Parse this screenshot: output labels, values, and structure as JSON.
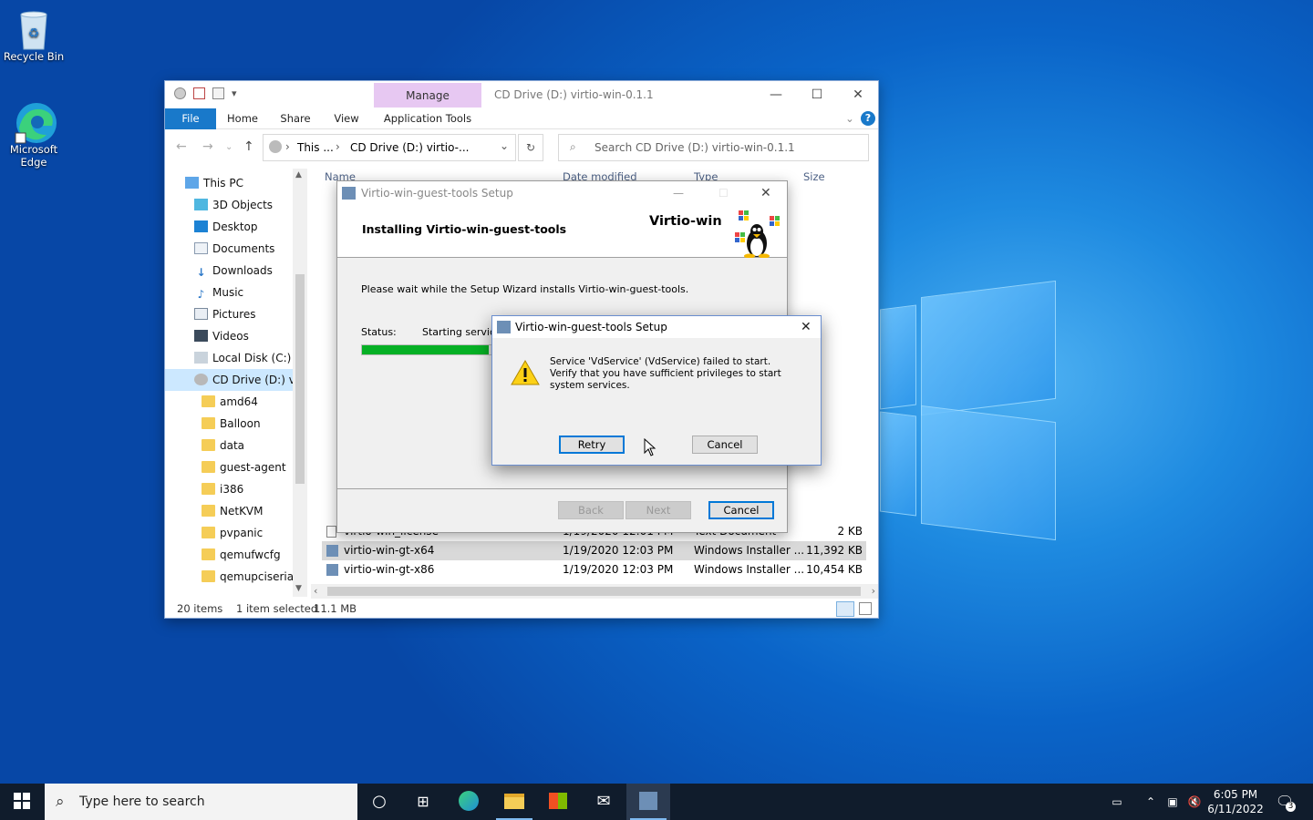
{
  "desktop": {
    "icons": [
      {
        "label": "Recycle Bin",
        "icon": "recycle-bin-icon"
      },
      {
        "label": "Microsoft Edge",
        "icon": "edge-icon"
      }
    ]
  },
  "explorer": {
    "manage_tab": "Manage",
    "title": "CD Drive (D:) virtio-win-0.1.1",
    "ribbon_tabs": [
      "File",
      "Home",
      "Share",
      "View",
      "Application Tools"
    ],
    "breadcrumb": [
      "This ...",
      "CD Drive (D:) virtio-..."
    ],
    "search_placeholder": "Search CD Drive (D:) virtio-win-0.1.1",
    "nav_items": [
      {
        "label": "This PC",
        "icon": "pc-icon"
      },
      {
        "label": "3D Objects",
        "icon": "3d-objects-icon"
      },
      {
        "label": "Desktop",
        "icon": "desktop-icon"
      },
      {
        "label": "Documents",
        "icon": "documents-icon"
      },
      {
        "label": "Downloads",
        "icon": "downloads-icon"
      },
      {
        "label": "Music",
        "icon": "music-icon"
      },
      {
        "label": "Pictures",
        "icon": "pictures-icon"
      },
      {
        "label": "Videos",
        "icon": "videos-icon"
      },
      {
        "label": "Local Disk (C:)",
        "icon": "disk-icon"
      },
      {
        "label": "CD Drive (D:) virt",
        "icon": "cd-drive-icon"
      },
      {
        "label": "amd64",
        "icon": "folder-icon"
      },
      {
        "label": "Balloon",
        "icon": "folder-icon"
      },
      {
        "label": "data",
        "icon": "folder-icon"
      },
      {
        "label": "guest-agent",
        "icon": "folder-icon"
      },
      {
        "label": "i386",
        "icon": "folder-icon"
      },
      {
        "label": "NetKVM",
        "icon": "folder-icon"
      },
      {
        "label": "pvpanic",
        "icon": "folder-icon"
      },
      {
        "label": "qemufwcfg",
        "icon": "folder-icon"
      },
      {
        "label": "qemupciserial",
        "icon": "folder-icon"
      }
    ],
    "columns": [
      "Name",
      "Date modified",
      "Type",
      "Size"
    ],
    "files": [
      {
        "name": "virtio-win_license",
        "date": "1/19/2020 12:01 PM",
        "type": "Text Document",
        "size": "2 KB"
      },
      {
        "name": "virtio-win-gt-x64",
        "date": "1/19/2020 12:03 PM",
        "type": "Windows Installer ...",
        "size": "11,392 KB"
      },
      {
        "name": "virtio-win-gt-x86",
        "date": "1/19/2020 12:03 PM",
        "type": "Windows Installer ...",
        "size": "10,454 KB"
      }
    ],
    "status": {
      "count": "20 items",
      "selection": "1 item selected",
      "size": "11.1 MB"
    }
  },
  "setup": {
    "title": "Virtio-win-guest-tools Setup",
    "heading": "Installing Virtio-win-guest-tools",
    "brand": "Virtio-win",
    "description": "Please wait while the Setup Wizard installs Virtio-win-guest-tools.",
    "status_label": "Status:",
    "status_value": "Starting service",
    "progress": 0.45,
    "back_label": "Back",
    "next_label": "Next",
    "cancel_label": "Cancel"
  },
  "message": {
    "title": "Virtio-win-guest-tools Setup",
    "text": "Service 'VdService' (VdService) failed to start.  Verify that you have sufficient privileges to start system services.",
    "retry_label": "Retry",
    "cancel_label": "Cancel"
  },
  "taskbar": {
    "search_placeholder": "Type here to search",
    "time": "6:05 PM",
    "date": "6/11/2022",
    "notifications": "3"
  }
}
